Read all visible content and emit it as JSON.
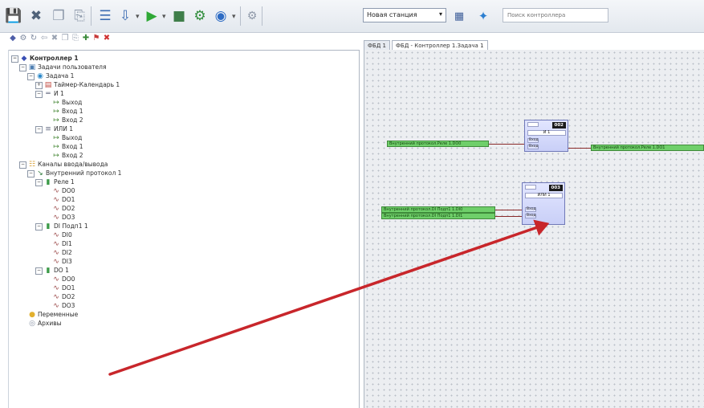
{
  "toolbar": {
    "station_select_value": "Новая станция",
    "search_placeholder": "Поиск контроллера",
    "icons": [
      "save-icon",
      "cut-icon",
      "copy-icon",
      "paste-icon",
      "list-icon",
      "download-icon",
      "run-icon",
      "stop-icon",
      "tool-icon",
      "globe-icon",
      "settings-icon",
      "calculator-icon",
      "navigate-icon"
    ]
  },
  "tree": {
    "items": [
      {
        "label": "Контроллер 1",
        "level": 0,
        "icon": "controller-icon",
        "bold": true,
        "expander": "−"
      },
      {
        "label": "Задачи пользователя",
        "level": 1,
        "icon": "tasks-icon",
        "expander": "−"
      },
      {
        "label": "Задача 1",
        "level": 2,
        "icon": "task-icon",
        "expander": "−"
      },
      {
        "label": "Таймер-Календарь 1",
        "level": 3,
        "icon": "calendar-icon",
        "expander": "+"
      },
      {
        "label": "И 1",
        "level": 3,
        "icon": "and-block-icon",
        "expander": "−"
      },
      {
        "label": "Выход",
        "level": 4,
        "icon": "pin-icon"
      },
      {
        "label": "Вход 1",
        "level": 4,
        "icon": "pin-icon"
      },
      {
        "label": "Вход 2",
        "level": 4,
        "icon": "pin-icon"
      },
      {
        "label": "ИЛИ 1",
        "level": 3,
        "icon": "or-block-icon",
        "expander": "−"
      },
      {
        "label": "Выход",
        "level": 4,
        "icon": "pin-icon"
      },
      {
        "label": "Вход 1",
        "level": 4,
        "icon": "pin-icon"
      },
      {
        "label": "Вход 2",
        "level": 4,
        "icon": "pin-icon"
      },
      {
        "label": "Каналы ввода/вывода",
        "level": 1,
        "icon": "io-channels-icon",
        "expander": "−"
      },
      {
        "label": "Внутренний протокол 1",
        "level": 2,
        "icon": "protocol-icon",
        "expander": "−"
      },
      {
        "label": "Реле 1",
        "level": 3,
        "icon": "module-icon",
        "expander": "−"
      },
      {
        "label": "DO0",
        "level": 4,
        "icon": "signal-icon"
      },
      {
        "label": "DO1",
        "level": 4,
        "icon": "signal-icon"
      },
      {
        "label": "DO2",
        "level": 4,
        "icon": "signal-icon"
      },
      {
        "label": "DO3",
        "level": 4,
        "icon": "signal-icon"
      },
      {
        "label": "DI Подп1 1",
        "level": 3,
        "icon": "module-icon",
        "expander": "−"
      },
      {
        "label": "DI0",
        "level": 4,
        "icon": "signal-icon"
      },
      {
        "label": "DI1",
        "level": 4,
        "icon": "signal-icon"
      },
      {
        "label": "DI2",
        "level": 4,
        "icon": "signal-icon"
      },
      {
        "label": "DI3",
        "level": 4,
        "icon": "signal-icon"
      },
      {
        "label": "DO 1",
        "level": 3,
        "icon": "module-icon",
        "expander": "−"
      },
      {
        "label": "DO0",
        "level": 4,
        "icon": "signal-icon"
      },
      {
        "label": "DO1",
        "level": 4,
        "icon": "signal-icon"
      },
      {
        "label": "DO2",
        "level": 4,
        "icon": "signal-icon"
      },
      {
        "label": "DO3",
        "level": 4,
        "icon": "signal-icon"
      },
      {
        "label": "Переменные",
        "level": 1,
        "icon": "variables-icon"
      },
      {
        "label": "Архивы",
        "level": 1,
        "icon": "archives-icon"
      }
    ]
  },
  "tabs": [
    {
      "label": "ФБД 1",
      "active": false
    },
    {
      "label": "ФБД - Контроллер 1.Задача 1",
      "active": true
    }
  ],
  "canvas": {
    "block1": {
      "number": "002",
      "name": "И 1",
      "pins": [
        "Вход",
        "Вход"
      ]
    },
    "block2": {
      "number": "003",
      "name": "ИЛИ 1",
      "pins": [
        "Вход",
        "Вход"
      ]
    },
    "signals": {
      "in1": "Внутренний протокол.Реле 1.DO0",
      "out1": "Внутренний протокол.Реле 1.DO1",
      "in2": "Внутренний протокол.DI Подп1 1.DI0",
      "in3": "Внутренний протокол.DI Подп1 1.DI1"
    }
  },
  "colors": {
    "arrow": "#c8262b",
    "signal": "#6fcf6a",
    "block": "#c9cff7"
  }
}
